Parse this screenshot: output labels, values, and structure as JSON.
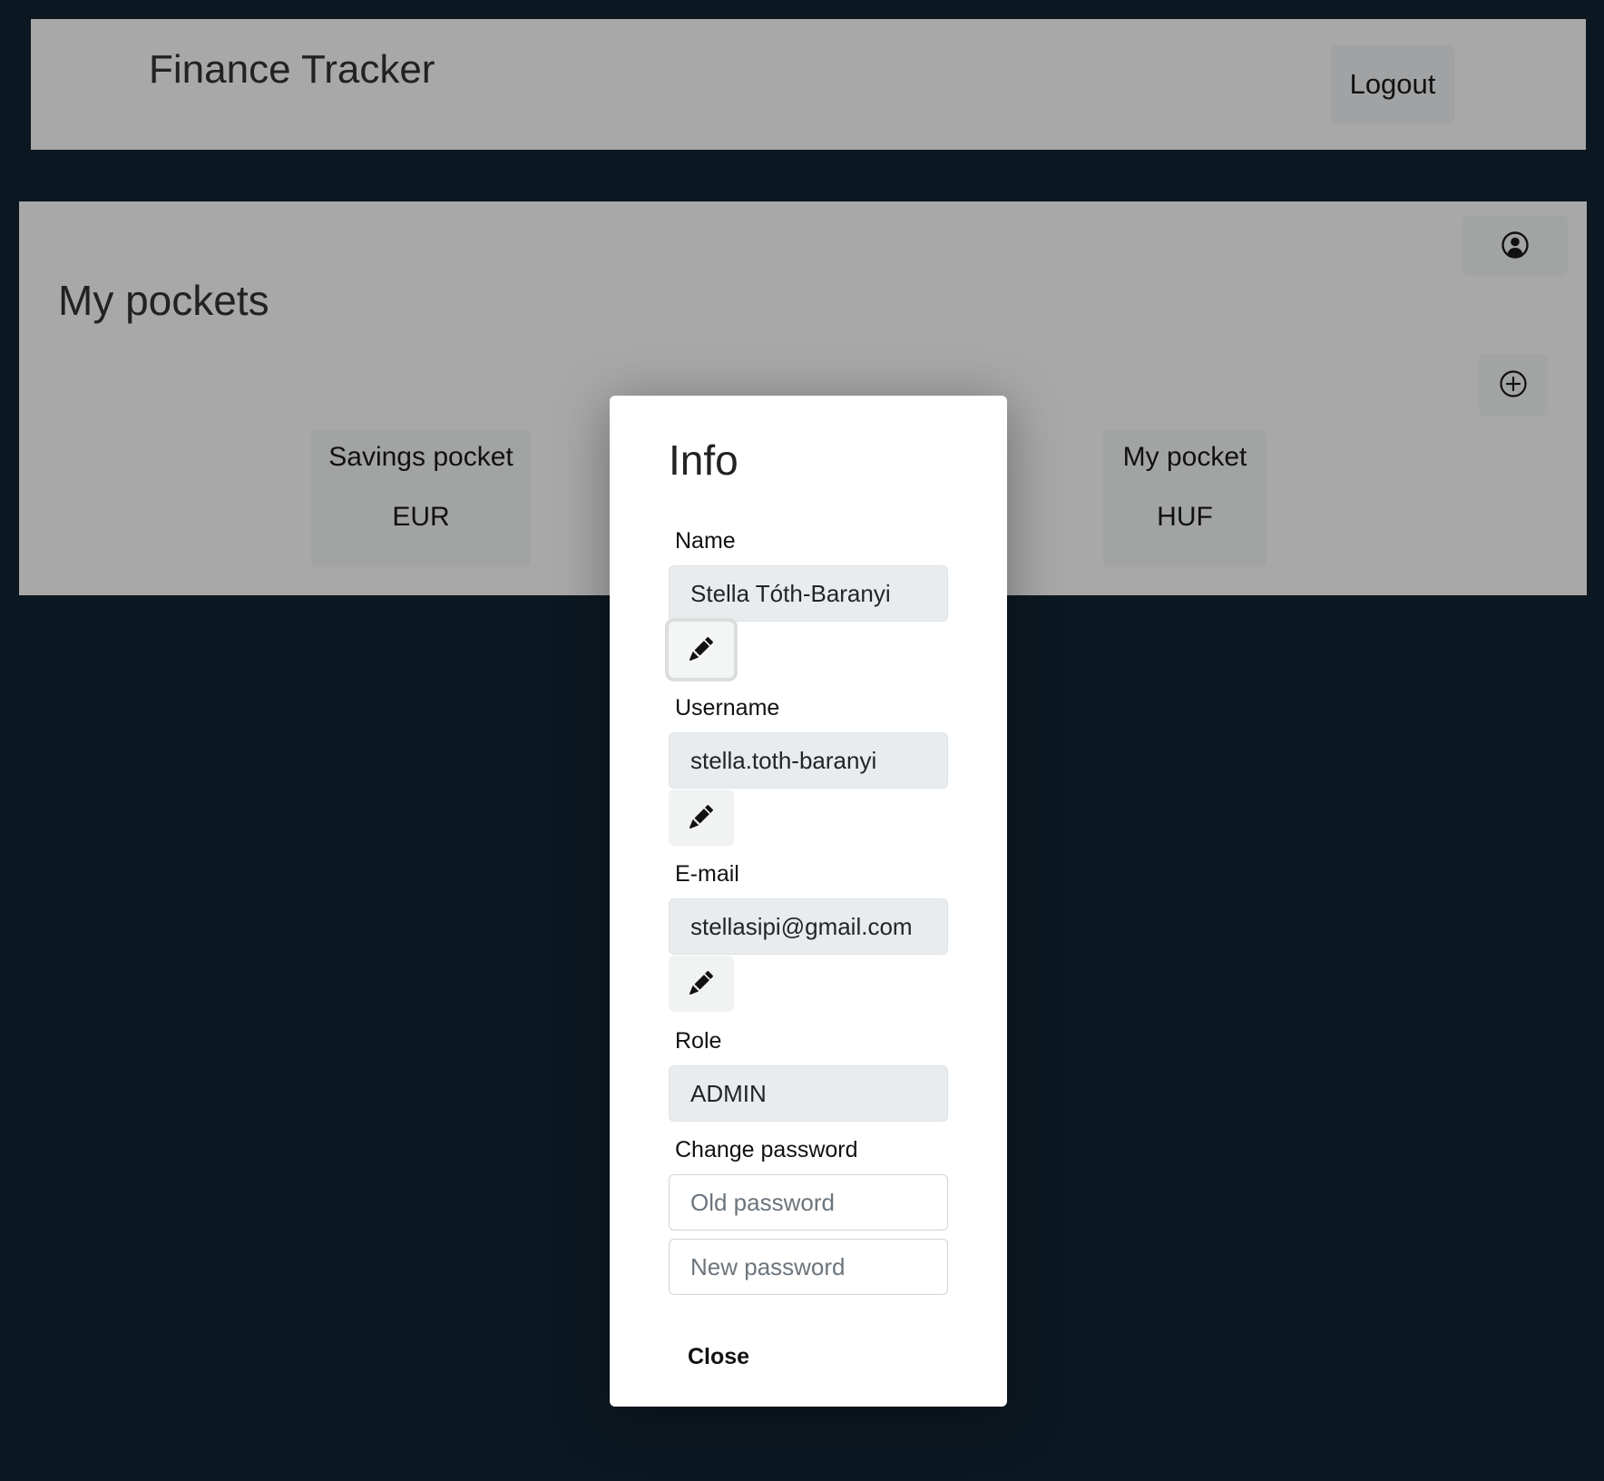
{
  "header": {
    "app_title": "Finance Tracker",
    "logout_label": "Logout"
  },
  "main": {
    "title": "My pockets",
    "profile_icon": "user-circle-icon",
    "add_icon": "plus-circle-icon",
    "pockets": [
      {
        "name": "Savings pocket",
        "currency": "EUR"
      },
      {
        "name": "My pocket",
        "currency": "HUF"
      }
    ]
  },
  "modal": {
    "title": "Info",
    "name_label": "Name",
    "name_value": "Stella Tóth-Baranyi",
    "username_label": "Username",
    "username_value": "stella.toth-baranyi",
    "email_label": "E-mail",
    "email_value": "stellasipi@gmail.com",
    "role_label": "Role",
    "role_value": "ADMIN",
    "change_password_label": "Change password",
    "old_password_placeholder": "Old password",
    "new_password_placeholder": "New password",
    "close_label": "Close",
    "edit_icon": "pencil-icon"
  },
  "colors": {
    "page_background": "#0c1821",
    "panel_background": "#a8a8a8",
    "modal_background": "#ffffff",
    "readonly_input": "#e9ecef"
  }
}
